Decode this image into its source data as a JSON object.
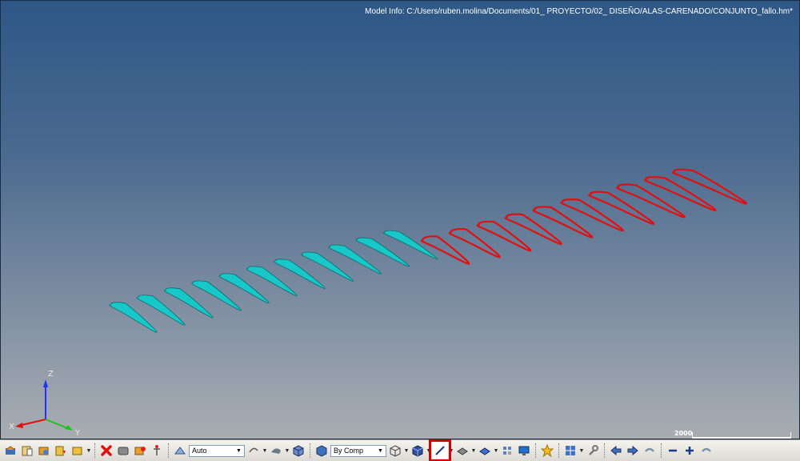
{
  "viewport": {
    "model_info": "Model Info: C:/Users/ruben.molina/Documents/01_ PROYECTO/02_ DISEÑO/ALAS-CARENADO/CONJUNTO_fallo.hm*",
    "background_top": "#2e5786",
    "background_bottom": "#a9adb2"
  },
  "scene": {
    "solid_color": "#18c8c8",
    "outline_color": "#e01010",
    "solid_sections": 11,
    "outline_sections": 10
  },
  "triad": {
    "z_label": "Z",
    "x_label": "X",
    "y_label": "Y"
  },
  "scale": {
    "label": "2000"
  },
  "toolbar": {
    "view_select": "Auto",
    "color_select": "By Comp",
    "highlighted_tool": "line-display-icon"
  }
}
